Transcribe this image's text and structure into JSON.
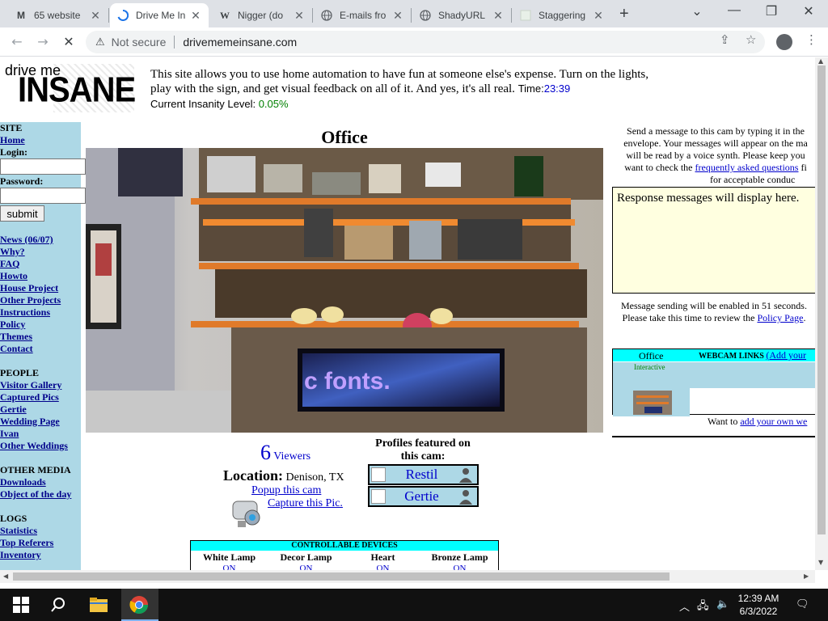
{
  "tabs": [
    {
      "label": "65 website",
      "icon": "M"
    },
    {
      "label": "Drive Me In",
      "icon": "loading"
    },
    {
      "label": "Nigger (do",
      "icon": "W"
    },
    {
      "label": "E-mails fro",
      "icon": "globe"
    },
    {
      "label": "ShadyURL",
      "icon": "globe"
    },
    {
      "label": "Staggering",
      "icon": "blank"
    }
  ],
  "address": {
    "security_label": "Not secure",
    "url": "drivememeinsane.com"
  },
  "site": {
    "logo_top": "drive me",
    "logo_main": "INSANE",
    "intro": "This site allows you to use home automation to have fun at someone else's expense. Turn on the lights, play with the sign, and get visual feedback on all of it. And yes, it's all real.",
    "time_label": "Time:",
    "time_value": "23:39",
    "insanity_label": "Current Insanity Level:",
    "insanity_value": "0.05%"
  },
  "sidebar": {
    "site_header": "SITE",
    "home": "Home",
    "login_label": "Login:",
    "password_label": "Password:",
    "submit": "submit",
    "links_main": [
      "News (06/07)",
      "Why?",
      "FAQ",
      "Howto",
      "House Project",
      "Other Projects",
      "Instructions",
      "Policy",
      "Themes",
      "Contact"
    ],
    "people_header": "PEOPLE",
    "links_people": [
      "Visitor Gallery",
      "Captured Pics",
      "Gertie",
      "Wedding Page",
      "Ivan",
      "Other Weddings"
    ],
    "media_header": "OTHER MEDIA",
    "links_media": [
      "Downloads",
      "Object of the day"
    ],
    "logs_header": "LOGS",
    "links_logs": [
      "Statistics",
      "Top Referers",
      "Inventory"
    ]
  },
  "cam": {
    "title": "Office",
    "sign_text": "c fonts.",
    "viewers_count": "6",
    "viewers_label": "Viewers",
    "location_label": "Location:",
    "location_value": "Denison, TX",
    "popup_link": "Popup this cam",
    "capture_link": "Capture this Pic.",
    "profiles_title": "Profiles featured on this cam:",
    "profiles": [
      "Restil",
      "Gertie"
    ]
  },
  "devices": {
    "header": "CONTROLLABLE DEVICES",
    "columns": [
      "White Lamp",
      "Decor Lamp",
      "Heart",
      "Bronze Lamp"
    ],
    "states": [
      "ON",
      "ON",
      "ON",
      "ON"
    ]
  },
  "messages": {
    "line1": "Send a message to this cam by typing it in the",
    "line2": "envelope. Your messages will appear on the ma",
    "line3": "will be read by a voice synth. Please keep you",
    "line4_pre": "want to check the",
    "faq_link": "frequently asked questions",
    "line4_post": "fi",
    "line5": "for acceptable conduc",
    "response_placeholder": "Response messages will display here.",
    "sending_line1": "Message sending will be enabled in 51 seconds.",
    "sending_line2_pre": "Please take this time to review the",
    "policy_link": "Policy Page",
    "sending_line2_post": "."
  },
  "webcam_links": {
    "header": "WEBCAM LINKS",
    "add_link": "(Add your",
    "cam_name": "Office",
    "cam_type": "Interactive",
    "add_own_pre": "Want to",
    "add_own_link": "add your own we"
  },
  "taskbar": {
    "time": "12:39 AM",
    "date": "6/3/2022"
  },
  "colors": {
    "sidebar_bg": "#add8e6",
    "header_cyan": "#00ffff",
    "link_blue": "#0000cc",
    "response_bg": "#ffffe0"
  }
}
